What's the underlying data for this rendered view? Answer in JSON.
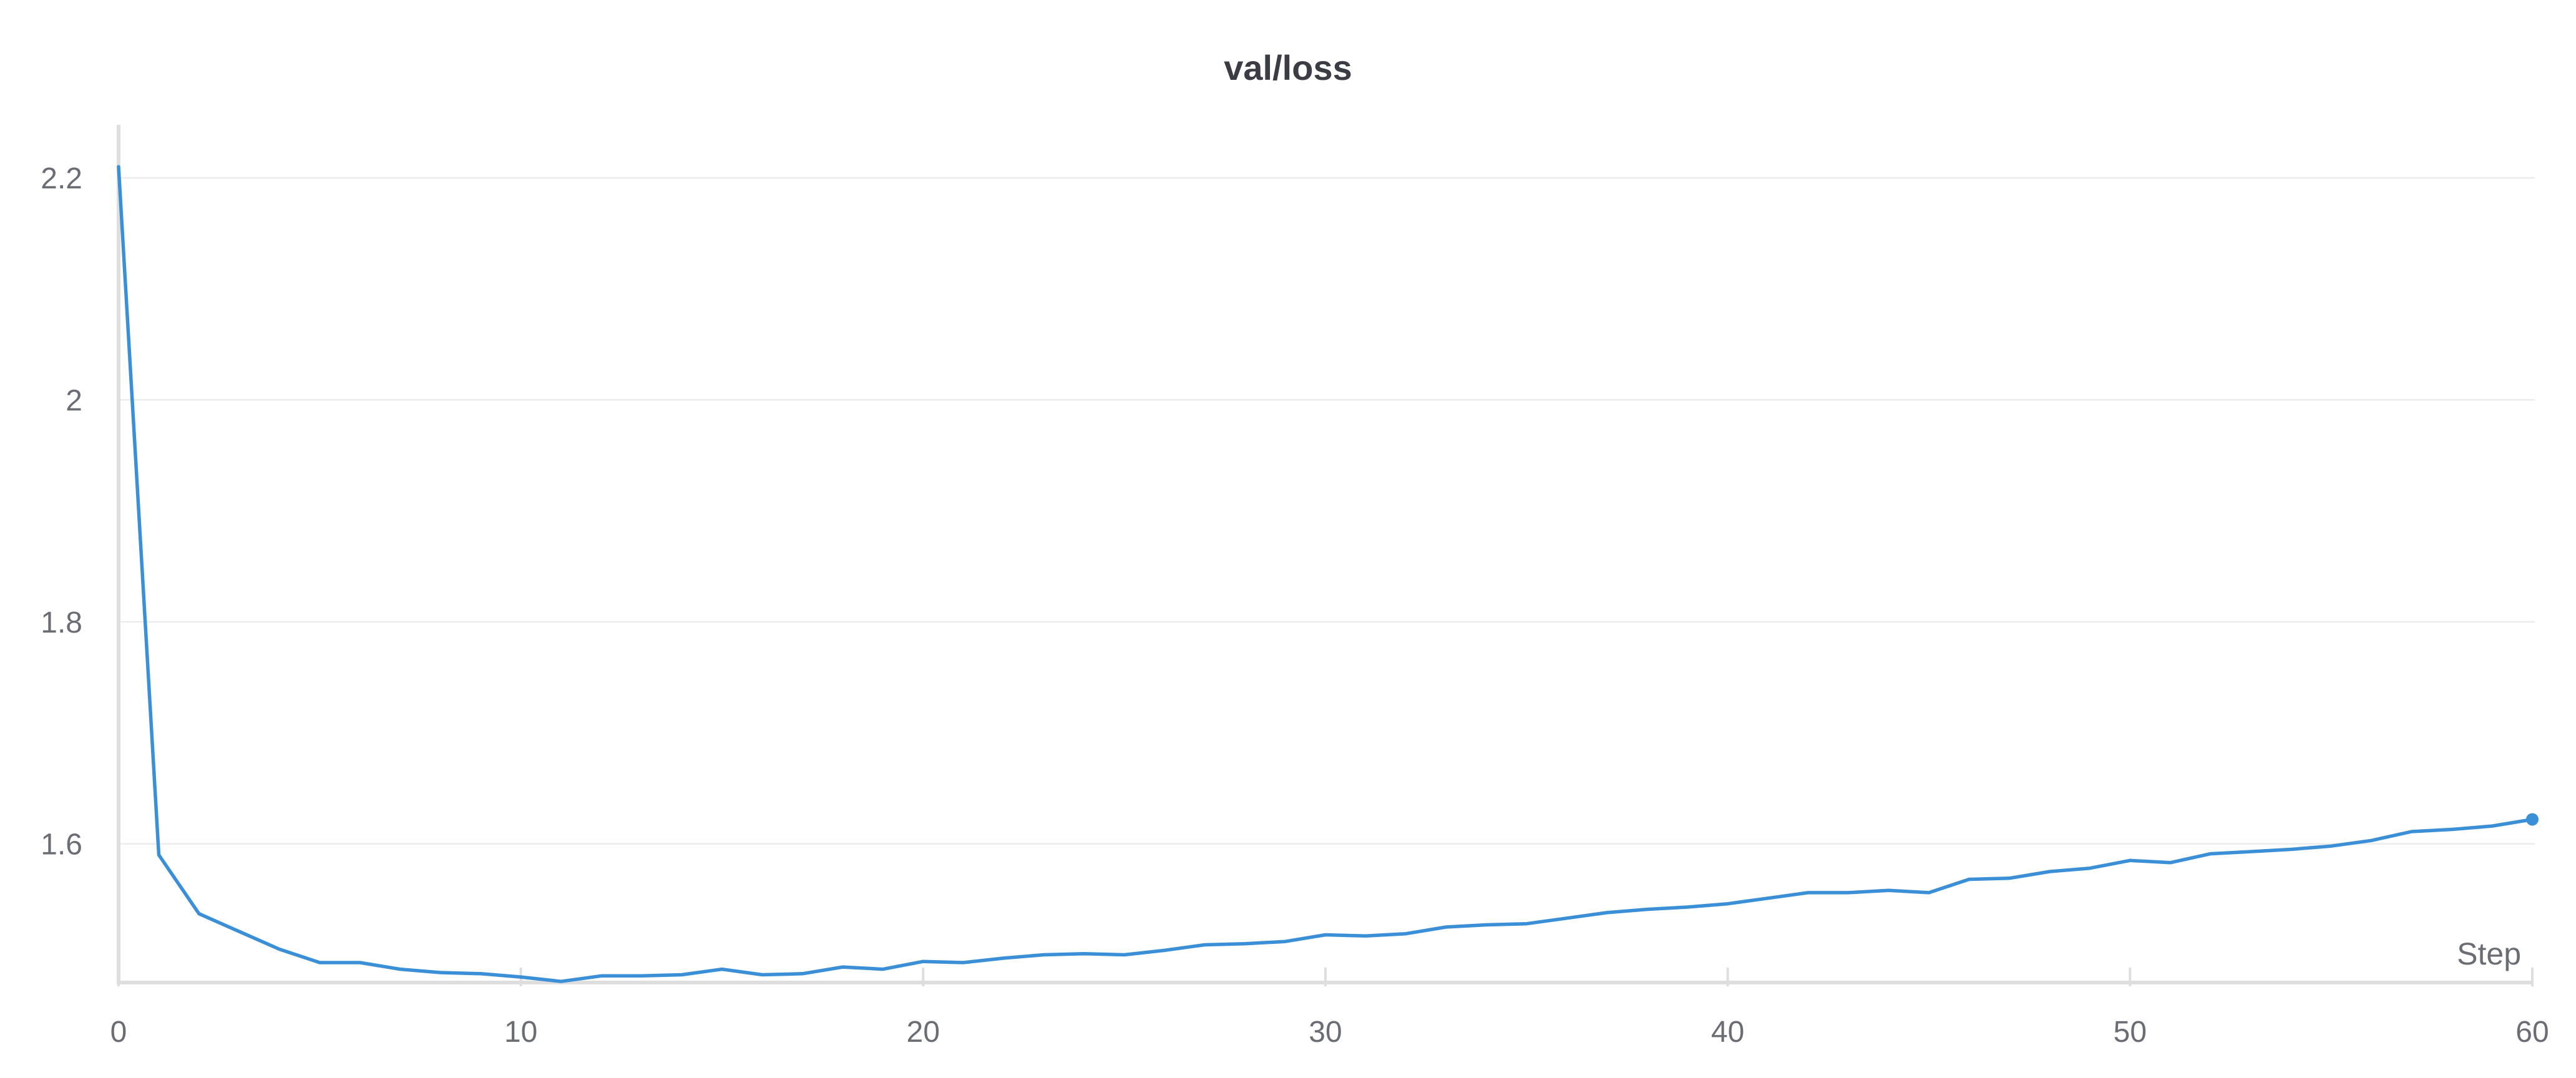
{
  "chart_data": {
    "type": "line",
    "title": "val/loss",
    "xlabel": "Step",
    "ylabel": "",
    "xlim": [
      0,
      60
    ],
    "ylim": [
      1.475,
      2.245
    ],
    "x_ticks": [
      "0",
      "10",
      "20",
      "30",
      "40",
      "50",
      "60"
    ],
    "y_ticks": [
      "1.6",
      "1.8",
      "2",
      "2.2"
    ],
    "grid": true,
    "series": [
      {
        "color": "#3a8fd6",
        "x": [
          0,
          1,
          2,
          3,
          4,
          5,
          6,
          7,
          8,
          9,
          10,
          11,
          12,
          13,
          14,
          15,
          16,
          17,
          18,
          19,
          20,
          21,
          22,
          23,
          24,
          25,
          26,
          27,
          28,
          29,
          30,
          31,
          32,
          33,
          34,
          35,
          36,
          37,
          38,
          39,
          40,
          41,
          42,
          43,
          44,
          45,
          46,
          47,
          48,
          49,
          50,
          51,
          52,
          53,
          54,
          55,
          56,
          57,
          58,
          59,
          60
        ],
        "values": [
          2.21,
          1.59,
          1.537,
          1.521,
          1.505,
          1.493,
          1.493,
          1.487,
          1.484,
          1.483,
          1.48,
          1.476,
          1.481,
          1.481,
          1.482,
          1.487,
          1.482,
          1.483,
          1.489,
          1.487,
          1.494,
          1.493,
          1.497,
          1.5,
          1.501,
          1.5,
          1.504,
          1.509,
          1.51,
          1.512,
          1.518,
          1.517,
          1.519,
          1.525,
          1.527,
          1.528,
          1.533,
          1.538,
          1.541,
          1.543,
          1.546,
          1.551,
          1.556,
          1.556,
          1.558,
          1.556,
          1.568,
          1.569,
          1.575,
          1.578,
          1.585,
          1.583,
          1.591,
          1.593,
          1.595,
          1.598,
          1.603,
          1.611,
          1.613,
          1.616,
          1.622
        ]
      }
    ]
  }
}
